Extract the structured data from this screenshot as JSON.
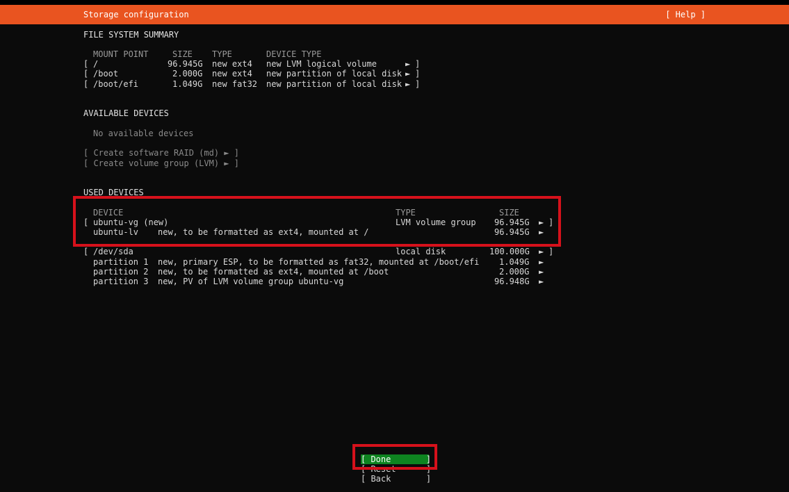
{
  "header": {
    "title": "Storage configuration",
    "help": "[ Help ]"
  },
  "fs_summary": {
    "title": "FILE SYSTEM SUMMARY",
    "columns": [
      "MOUNT POINT",
      "SIZE",
      "TYPE",
      "DEVICE TYPE"
    ],
    "rows": [
      {
        "open": "[",
        "mount": "/",
        "size": "96.945G",
        "type": "new ext4",
        "device_type": "new LVM logical volume",
        "arrow": "►",
        "close": "]"
      },
      {
        "open": "[",
        "mount": "/boot",
        "size": "2.000G",
        "type": "new ext4",
        "device_type": "new partition of local disk",
        "arrow": "►",
        "close": "]"
      },
      {
        "open": "[",
        "mount": "/boot/efi",
        "size": "1.049G",
        "type": "new fat32",
        "device_type": "new partition of local disk",
        "arrow": "►",
        "close": "]"
      }
    ]
  },
  "available": {
    "title": "AVAILABLE DEVICES",
    "empty_text": "No available devices",
    "create_raid": "[ Create software RAID (md) ► ]",
    "create_vg": "[ Create volume group (LVM) ► ]"
  },
  "used": {
    "title": "USED DEVICES",
    "columns": {
      "device": "DEVICE",
      "type": "TYPE",
      "size": "SIZE"
    },
    "vg": {
      "open": "[",
      "name": "ubuntu-vg (new)",
      "type": "LVM volume group",
      "size": "96.945G",
      "arrow": "►",
      "close": "]"
    },
    "lv": {
      "name": "ubuntu-lv",
      "desc": "new, to be formatted as ext4, mounted at /",
      "size": "96.945G",
      "arrow": "►"
    },
    "disk": {
      "open": "[",
      "name": "/dev/sda",
      "type": "local disk",
      "size": "100.000G",
      "arrow": "►",
      "close": "]"
    },
    "partitions": [
      {
        "name": "partition 1",
        "desc": "new, primary ESP, to be formatted as fat32, mounted at /boot/efi",
        "size": "1.049G",
        "arrow": "►"
      },
      {
        "name": "partition 2",
        "desc": "new, to be formatted as ext4, mounted at /boot",
        "size": "2.000G",
        "arrow": "►"
      },
      {
        "name": "partition 3",
        "desc": "new, PV of LVM volume group ubuntu-vg",
        "size": "96.948G",
        "arrow": "►"
      }
    ]
  },
  "buttons": {
    "done": "[ Done       ]",
    "reset": "[ Reset      ]",
    "back": "[ Back       ]"
  },
  "colors": {
    "accent": "#e95420",
    "highlight_box": "#d6111b",
    "done_button": "#0e8420",
    "background": "#0b0b0b"
  }
}
